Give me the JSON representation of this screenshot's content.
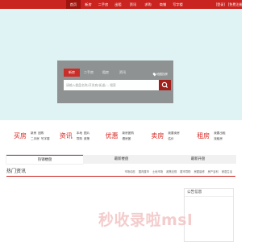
{
  "header": {
    "nav": [
      "首页",
      "新房",
      "二手房",
      "出租",
      "资讯",
      "求购",
      "商铺",
      "写字楼"
    ],
    "active_index": 0,
    "links": [
      "[登录]",
      "[免费注册]"
    ],
    "accent_color": "#c9241f"
  },
  "search": {
    "tabs": [
      "新房",
      "二手房",
      "租房",
      "资讯"
    ],
    "active_tab": 0,
    "map_label": "地图找房",
    "placeholder": "请输入楼盘名称/开发商/街道/... 搜索",
    "button_icon": "search-icon"
  },
  "categories": [
    {
      "title": "买房",
      "links": [
        "新房",
        "团购",
        "二手房",
        "写字楼"
      ]
    },
    {
      "title": "资讯",
      "links": [
        "本地",
        "图片",
        "导购",
        "政策"
      ]
    },
    {
      "title": "优惠",
      "links": [
        "新房团购",
        "看房团"
      ]
    },
    {
      "title": "卖房",
      "links": [
        "我要卖房",
        "估价"
      ]
    },
    {
      "title": "租房",
      "links": [
        "我要出租",
        "找租房"
      ]
    }
  ],
  "tabs": {
    "items": [
      "热销楼盘",
      "最新楼盘",
      "最新开盘"
    ],
    "active_index": 0
  },
  "hot_news": {
    "title": "热门资讯",
    "links": [
      "市场动态",
      "国内楼市",
      "土地市场",
      "政策法规",
      "楼市导购",
      "房屋装修",
      "房产百科",
      "家居生活"
    ]
  },
  "notice": {
    "title": "公告信息"
  },
  "watermark": "秒收录啦msl"
}
